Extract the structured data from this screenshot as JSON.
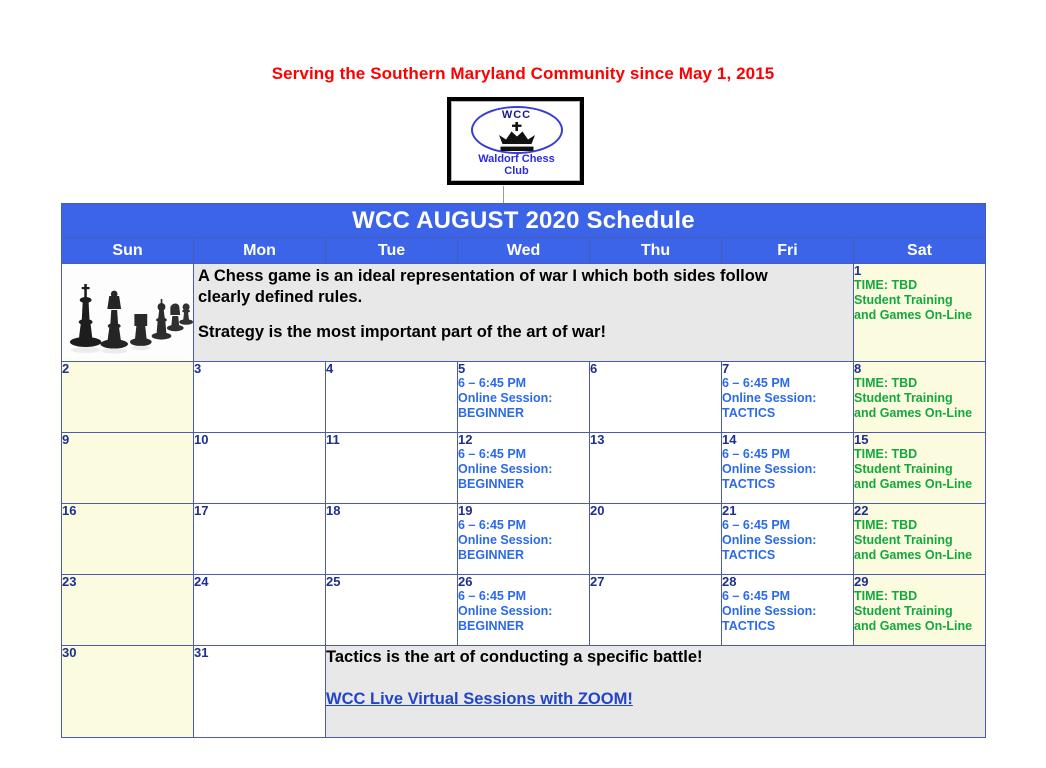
{
  "header": {
    "tagline": "Serving the Southern Maryland Community since May 1, 2015"
  },
  "logo": {
    "monogram": "WCC",
    "name_line1": "Waldorf Chess",
    "name_line2": "Club",
    "icon": "chess-king-crown-icon",
    "ellipse_color": "#3b3bd8",
    "text_color": "#2b2be0"
  },
  "calendar": {
    "title": "WCC AUGUST 2020 Schedule",
    "title_bg": "#3c64e8",
    "day_headers": [
      "Sun",
      "Mon",
      "Tue",
      "Wed",
      "Thu",
      "Fri",
      "Sat"
    ],
    "colors": {
      "border": "#4a5ab5",
      "weekend_bg": "#fbfbe0",
      "weekday_bg": "#ffffff",
      "note_bg": "#e8e8e8",
      "daynum": "#1f2f8f",
      "session_text": "#2b6ae8",
      "saturday_text": "#15a83c",
      "link": "#2245c8",
      "tagline": "#ff0000"
    },
    "week1": {
      "pieces_image": "chess-pieces-photo",
      "quote_line1": "A Chess game is an ideal representation of war I which both sides follow",
      "quote_line2": "clearly defined rules.",
      "quote_line3": "Strategy is the most important part of the art of war!",
      "sat": {
        "day": "1",
        "lines": [
          "TIME: TBD",
          "Student Training",
          "and Games On-Line"
        ]
      }
    },
    "weeks": [
      {
        "sun": {
          "day": "2",
          "lines": []
        },
        "mon": {
          "day": "3",
          "lines": []
        },
        "tue": {
          "day": "4",
          "lines": []
        },
        "wed": {
          "day": "5",
          "lines": [
            "6 – 6:45 PM",
            "Online Session:",
            "BEGINNER"
          ]
        },
        "thu": {
          "day": "6",
          "lines": []
        },
        "fri": {
          "day": "7",
          "lines": [
            "6 – 6:45 PM",
            "Online Session:",
            "TACTICS"
          ]
        },
        "sat": {
          "day": "8",
          "lines": [
            "TIME: TBD",
            "Student Training",
            "and Games On-Line"
          ]
        }
      },
      {
        "sun": {
          "day": "9",
          "lines": []
        },
        "mon": {
          "day": "10",
          "lines": []
        },
        "tue": {
          "day": "11",
          "lines": []
        },
        "wed": {
          "day": "12",
          "lines": [
            "6 – 6:45 PM",
            "Online Session:",
            "BEGINNER"
          ]
        },
        "thu": {
          "day": "13",
          "lines": []
        },
        "fri": {
          "day": "14",
          "lines": [
            "6 – 6:45 PM",
            "Online Session:",
            "TACTICS"
          ]
        },
        "sat": {
          "day": "15",
          "lines": [
            "TIME: TBD",
            "Student Training",
            "and Games On-Line"
          ]
        }
      },
      {
        "sun": {
          "day": "16",
          "lines": []
        },
        "mon": {
          "day": "17",
          "lines": []
        },
        "tue": {
          "day": "18",
          "lines": []
        },
        "wed": {
          "day": "19",
          "lines": [
            "6 – 6:45 PM",
            "Online Session:",
            "BEGINNER"
          ]
        },
        "thu": {
          "day": "20",
          "lines": []
        },
        "fri": {
          "day": "21",
          "lines": [
            "6 – 6:45 PM",
            "Online Session:",
            "TACTICS"
          ]
        },
        "sat": {
          "day": "22",
          "lines": [
            "TIME: TBD",
            "Student Training",
            "and Games On-Line"
          ]
        }
      },
      {
        "sun": {
          "day": "23",
          "lines": []
        },
        "mon": {
          "day": "24",
          "lines": []
        },
        "tue": {
          "day": "25",
          "lines": []
        },
        "wed": {
          "day": "26",
          "lines": [
            "6 – 6:45 PM",
            "Online Session:",
            "BEGINNER"
          ]
        },
        "thu": {
          "day": "27",
          "lines": []
        },
        "fri": {
          "day": "28",
          "lines": [
            "6 – 6:45 PM",
            "Online Session:",
            "TACTICS"
          ]
        },
        "sat": {
          "day": "29",
          "lines": [
            "TIME: TBD",
            "Student Training",
            "and Games On-Line"
          ]
        }
      }
    ],
    "lastweek": {
      "sun": {
        "day": "30"
      },
      "mon": {
        "day": "31"
      },
      "note_line": "Tactics is the art of conducting a specific battle!",
      "note_link": "WCC Live Virtual Sessions with ZOOM!"
    }
  }
}
